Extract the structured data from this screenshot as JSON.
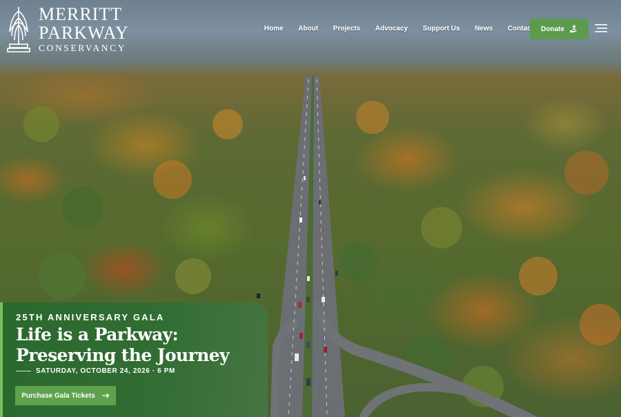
{
  "brand": {
    "name_line1": "MERRITT",
    "name_line2": "PARKWAY",
    "name_line3": "CONSERVANCY",
    "emblem_icon": "winged-pylon-emblem-icon"
  },
  "nav": {
    "items": [
      {
        "label": "Home"
      },
      {
        "label": "About"
      },
      {
        "label": "Projects"
      },
      {
        "label": "Advocacy"
      },
      {
        "label": "Support Us"
      },
      {
        "label": "News"
      },
      {
        "label": "Contact"
      }
    ],
    "donate_label": "Donate",
    "donate_icon": "hand-giving-icon",
    "menu_icon": "hamburger-menu-icon"
  },
  "hero": {
    "image_subject": "aerial-autumn-parkway"
  },
  "gala": {
    "eyebrow": "25TH ANNIVERSARY GALA",
    "title_line1": "Life is a Parkway:",
    "title_line2": "Preserving the Journey",
    "date": "SATURDAY, OCTOBER 24, 2026 · 6 PM",
    "cta_label": "Purchase Gala Tickets",
    "cta_icon": "arrow-right-icon"
  },
  "colors": {
    "accent_green": "#5c9b4e",
    "panel_green": "#2f6a31",
    "text": "#ffffff"
  }
}
